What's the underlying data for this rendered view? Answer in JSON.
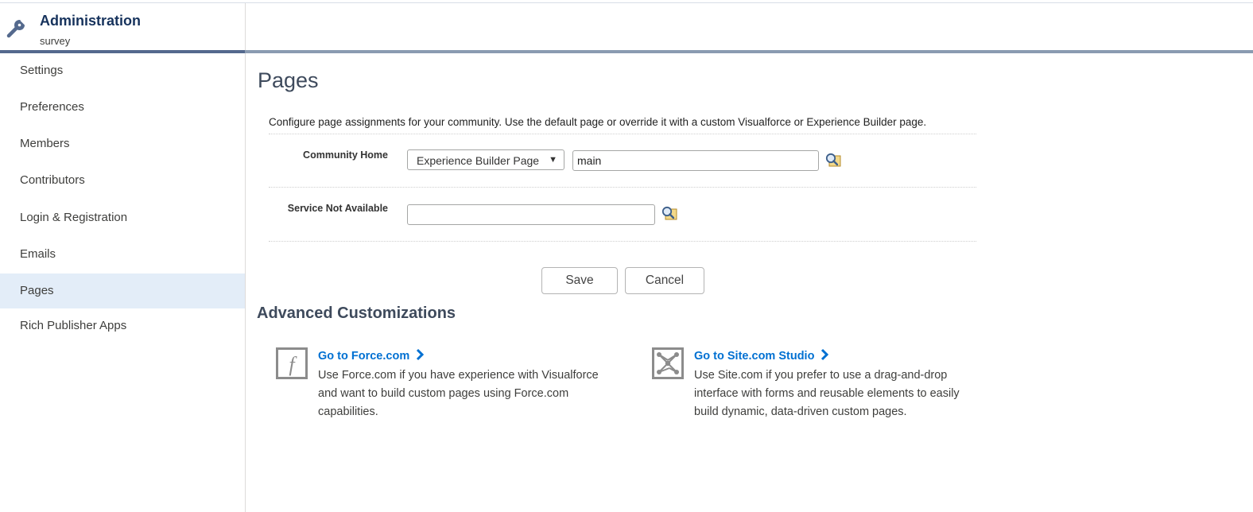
{
  "header": {
    "title": "Administration",
    "subtitle": "survey"
  },
  "sidebar": {
    "items": [
      {
        "label": "Settings"
      },
      {
        "label": "Preferences"
      },
      {
        "label": "Members"
      },
      {
        "label": "Contributors"
      },
      {
        "label": "Login & Registration"
      },
      {
        "label": "Emails"
      },
      {
        "label": "Pages"
      },
      {
        "label": "Rich Publisher Apps"
      }
    ],
    "active": "Pages"
  },
  "main": {
    "title": "Pages",
    "description": "Configure page assignments for your community. Use the default page or override it with a custom Visualforce or Experience Builder page.",
    "fields": {
      "community_home": {
        "label": "Community Home",
        "type_value": "Experience Builder Page",
        "page_value": "main"
      },
      "service_not_available": {
        "label": "Service Not Available",
        "page_value": ""
      }
    },
    "buttons": {
      "save": "Save",
      "cancel": "Cancel"
    },
    "advanced": {
      "title": "Advanced Customizations",
      "force": {
        "link": "Go to Force.com",
        "lines": [
          "Use Force.com if you have experience with Visualforce",
          "and want to build custom pages using Force.com",
          "capabilities."
        ]
      },
      "site": {
        "link": "Go to Site.com Studio",
        "lines": [
          "Use Site.com if you prefer to use a drag-and-drop",
          "interface with forms and reusable elements to easily",
          "build dynamic, data-driven custom pages."
        ]
      }
    }
  },
  "colors": {
    "link": "#0070d2",
    "active_item_bg": "#e3edf8",
    "header_bar": "#54698d"
  },
  "icons": [
    "wrench-icon",
    "lookup-icon",
    "force-icon",
    "site-icon",
    "chevron-right-icon"
  ]
}
